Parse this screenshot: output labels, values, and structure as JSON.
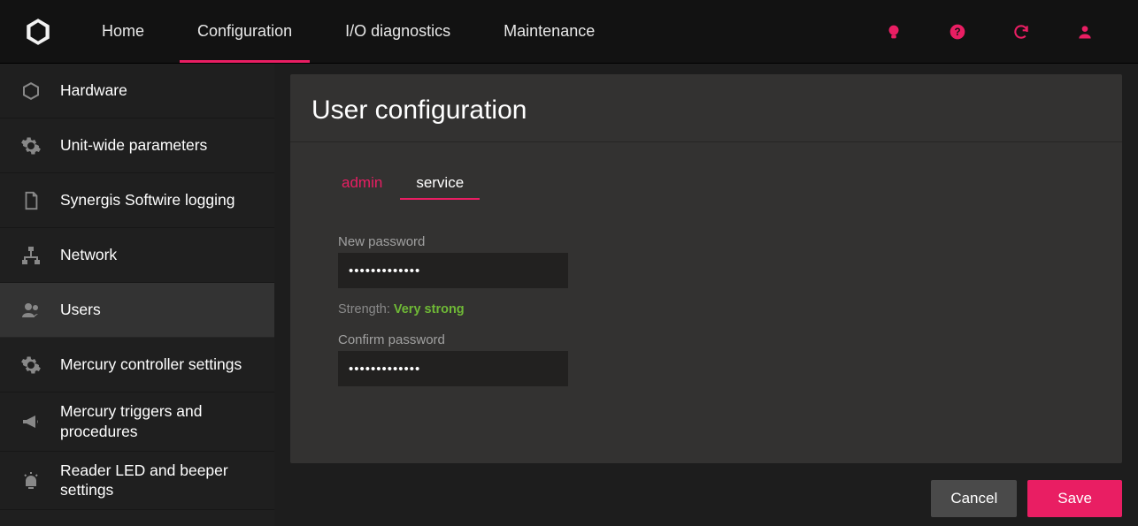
{
  "topnav": {
    "items": [
      {
        "label": "Home"
      },
      {
        "label": "Configuration"
      },
      {
        "label": "I/O diagnostics"
      },
      {
        "label": "Maintenance"
      }
    ],
    "active_index": 1
  },
  "sidebar": {
    "items": [
      {
        "label": "Hardware",
        "icon": "cube"
      },
      {
        "label": "Unit-wide parameters",
        "icon": "gear"
      },
      {
        "label": "Synergis Softwire logging",
        "icon": "document"
      },
      {
        "label": "Network",
        "icon": "network"
      },
      {
        "label": "Users",
        "icon": "users"
      },
      {
        "label": "Mercury controller settings",
        "icon": "gear"
      },
      {
        "label": "Mercury triggers and procedures",
        "icon": "megaphone"
      },
      {
        "label": "Reader LED and beeper settings",
        "icon": "beacon"
      }
    ],
    "active_index": 4
  },
  "page": {
    "title": "User configuration"
  },
  "tabs": {
    "items": [
      {
        "label": "admin"
      },
      {
        "label": "service"
      }
    ],
    "active_index": 1
  },
  "form": {
    "new_password_label": "New password",
    "new_password_value": "•••••••••••••",
    "strength_label": "Strength:",
    "strength_value": "Very strong",
    "confirm_password_label": "Confirm password",
    "confirm_password_value": "•••••••••••••"
  },
  "actions": {
    "cancel": "Cancel",
    "save": "Save"
  },
  "colors": {
    "accent": "#e91e63",
    "success": "#6fb936"
  }
}
